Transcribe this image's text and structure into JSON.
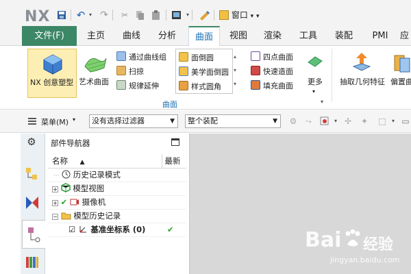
{
  "app": {
    "logo": "NX"
  },
  "quick_access": {
    "window_label": "窗口",
    "window_arrow": "▾",
    "more_arrow": "▾"
  },
  "tabs": [
    "文件(F)",
    "主页",
    "曲线",
    "分析",
    "曲面",
    "视图",
    "渲染",
    "工具",
    "装配",
    "PMI",
    "应"
  ],
  "active_tab": "曲面",
  "ribbon": {
    "nx_creative": "NX 创意塑型",
    "art_surface": "艺术曲面",
    "col1": [
      "通过曲线组",
      "扫掠",
      "规律延伸"
    ],
    "col2": [
      "面倒圆",
      "美学面倒圆",
      "样式圆角"
    ],
    "col3": [
      "四点曲面",
      "快速造面",
      "填充曲面"
    ],
    "more": "更多",
    "extract": "抽取几何特征",
    "offset": "偏置曲",
    "group_label": "曲面"
  },
  "filter_bar": {
    "menu_label": "菜单(M)",
    "filter_value": "没有选择过滤器",
    "assembly_value": "整个装配"
  },
  "navigator": {
    "title": "部件导航器",
    "col_name": "名称",
    "col_sort": "▲",
    "col_latest": "最新",
    "rows": [
      {
        "label": "历史记录模式",
        "expand": "",
        "check": "",
        "latest": ""
      },
      {
        "label": "模型视图",
        "expand": "+",
        "check": "",
        "latest": ""
      },
      {
        "label": "摄像机",
        "expand": "+",
        "check": "✔",
        "latest": ""
      },
      {
        "label": "模型历史记录",
        "expand": "−",
        "check": "",
        "latest": ""
      },
      {
        "label": "基准坐标系 (0)",
        "expand": "",
        "check": "☑",
        "latest": "✔"
      }
    ]
  },
  "watermark": {
    "brand": "Bai",
    "brand2": "经验",
    "url": "jingyan.baidu.com"
  },
  "colors": {
    "file_tab": "#3c8766",
    "active_tab_text": "#1b6fb2",
    "check_green": "#2aa52a",
    "viewport": "#d8d8d8"
  }
}
